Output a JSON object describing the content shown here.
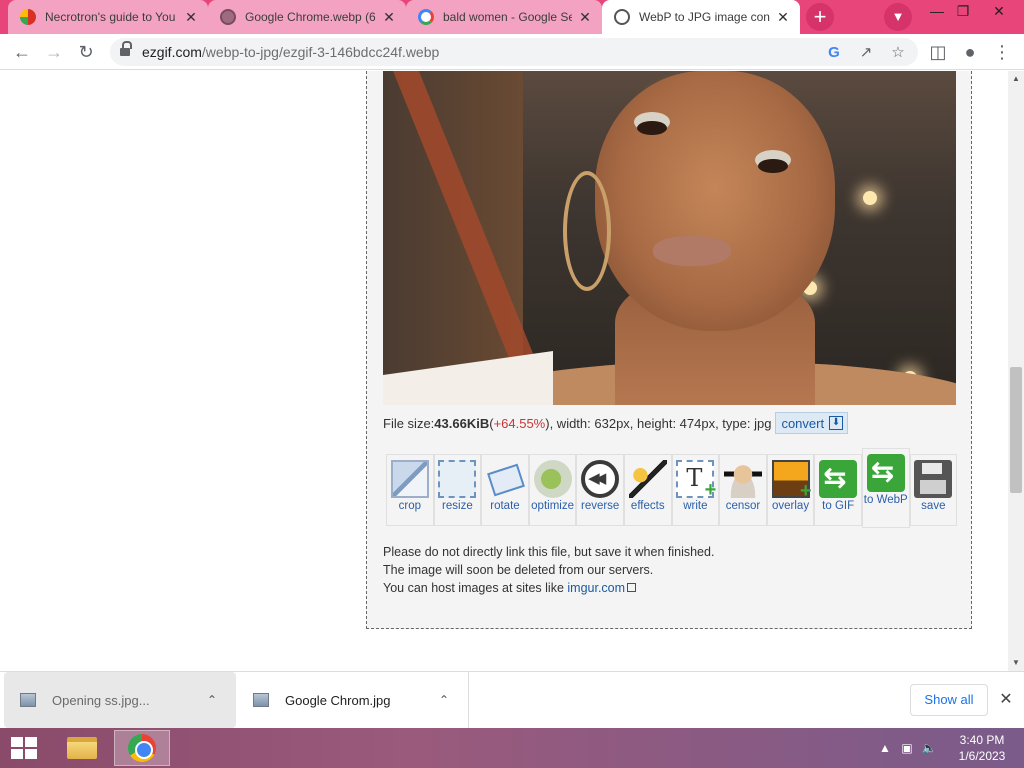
{
  "browser": {
    "tabs": [
      {
        "title": "Necrotron's guide to You",
        "active": false
      },
      {
        "title": "Google Chrome.webp (6",
        "active": false
      },
      {
        "title": "bald women - Google Se",
        "active": false
      },
      {
        "title": "WebP to JPG image conv",
        "active": true
      }
    ],
    "url_host": "ezgif.com",
    "url_path": "/webp-to-jpg/ezgif-3-146bdcc24f.webp",
    "accent_color": "#e8457a"
  },
  "page": {
    "file_info": {
      "label": "File size: ",
      "size": "43.66KiB",
      "open_paren": " (",
      "change": "+64.55%",
      "rest": "), width: 632px, height: 474px, type: jpg",
      "convert_label": "convert"
    },
    "tools": [
      {
        "label": "crop",
        "icon": "crop-icon"
      },
      {
        "label": "resize",
        "icon": "resize-icon"
      },
      {
        "label": "rotate",
        "icon": "rotate-icon"
      },
      {
        "label": "optimize",
        "icon": "optimize-icon"
      },
      {
        "label": "reverse",
        "icon": "reverse-icon"
      },
      {
        "label": "effects",
        "icon": "effects-icon"
      },
      {
        "label": "write",
        "icon": "write-icon"
      },
      {
        "label": "censor",
        "icon": "censor-icon"
      },
      {
        "label": "overlay",
        "icon": "overlay-icon"
      },
      {
        "label": "to GIF",
        "icon": "to-gif-icon"
      },
      {
        "label": "to WebP",
        "icon": "to-webp-icon"
      },
      {
        "label": "save",
        "icon": "save-icon"
      }
    ],
    "notes": {
      "line1": "Please do not directly link this file, but save it when finished.",
      "line2": "The image will soon be deleted from our servers.",
      "line3_prefix": "You can host images at sites like ",
      "line3_link": "imgur.com"
    }
  },
  "downloads": {
    "items": [
      {
        "name": "Opening ss.jpg..."
      },
      {
        "name": "Google Chrom.jpg"
      }
    ],
    "show_all_label": "Show all"
  },
  "taskbar": {
    "time": "3:40 PM",
    "date": "1/6/2023"
  }
}
